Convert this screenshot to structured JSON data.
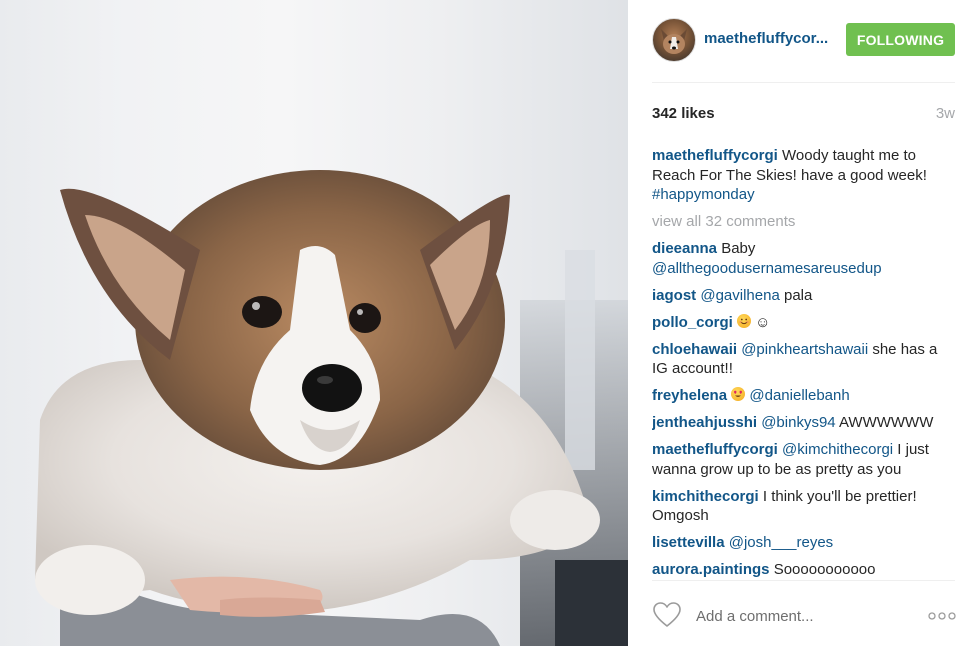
{
  "colors": {
    "link": "#125688",
    "follow_bg": "#70c050",
    "muted": "#a5a7aa",
    "text": "#262626"
  },
  "header": {
    "username": "maethefluffycor...",
    "follow_label": "FOLLOWING"
  },
  "stats": {
    "likes": "342 likes",
    "time": "3w"
  },
  "caption": {
    "user": "maethefluffycorgi",
    "text": " Woody taught me to Reach For The Skies! have a good week! ",
    "hashtag": "#happymonday"
  },
  "view_all": "view all 32 comments",
  "comments": [
    {
      "user": "dieeanna",
      "text": " Baby ",
      "mention": "@allthegoodusernamesareusedup"
    },
    {
      "user": "iagost",
      "mention": "@gavilhena",
      "text": " pala"
    },
    {
      "user": "pollo_corgi",
      "emoji": "smiling-face-icon",
      "text": " ☺"
    },
    {
      "user": "chloehawaii",
      "mention": "@pinkheartshawaii",
      "text": " she has a IG account!!"
    },
    {
      "user": "freyhelena",
      "emoji": "heart-eyes-icon",
      "mention": "@daniellebanh"
    },
    {
      "user": "jentheahjusshi",
      "mention": "@binkys94",
      "text": " AWWWWWW"
    },
    {
      "user": "maethefluffycorgi",
      "mention": "@kimchithecorgi",
      "text": " I just wanna grow up to be as pretty as you"
    },
    {
      "user": "kimchithecorgi",
      "text": " I think you'll be prettier! Omgosh"
    },
    {
      "user": "lisettevilla",
      "mention": "@josh___reyes"
    },
    {
      "user": "aurora.paintings",
      "text": " Sooooooooooo"
    }
  ],
  "footer": {
    "add_comment_placeholder": "Add a comment...",
    "like_icon": "heart-outline-icon",
    "more_icon": "more-options-icon"
  }
}
